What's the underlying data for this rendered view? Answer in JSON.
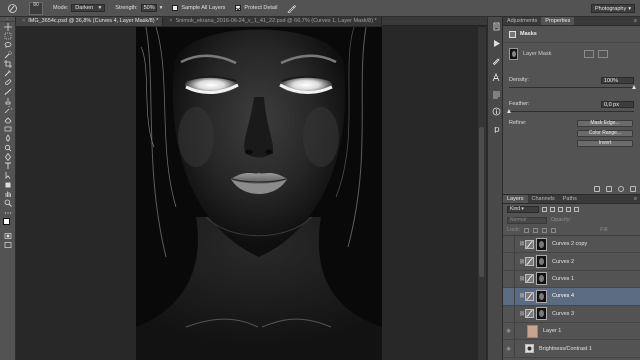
{
  "options_bar": {
    "brush_size": "80",
    "mode_label": "Mode:",
    "mode_value": "Darken",
    "strength_label": "Strength:",
    "strength_value": "50%",
    "sample_all_label": "Sample All Layers",
    "protect_detail_label": "Protect Detail",
    "workspace": "Photography"
  },
  "tabs": [
    {
      "label": "IMG_3654c.psd @ 36,8% (Curves 4, Layer Mask/8) *"
    },
    {
      "label": "Snimok_ekrana_2016-06-24_v_1_41_22.psd @ 66,7% (Curves 1, Layer Mask/8) *"
    }
  ],
  "panel_tabs": {
    "adjustments": "Adjustments",
    "properties": "Properties"
  },
  "properties": {
    "title": "Masks",
    "mask_type": "Layer Mask",
    "density_label": "Density:",
    "density_value": "100%",
    "density_level": 1.0,
    "feather_label": "Feather:",
    "feather_value": "0,0 px",
    "feather_level": 0.0,
    "refine_label": "Refine:",
    "mask_edge": "Mask Edge...",
    "color_range": "Color Range...",
    "invert": "Invert"
  },
  "layers_panel": {
    "tabs": [
      "Layers",
      "Channels",
      "Paths"
    ],
    "kind": "Kind",
    "blend_mode": "Normal",
    "opacity_label": "Opacity:",
    "lock_label": "Lock:",
    "fill_label": "Fill:",
    "layers": [
      {
        "name": "Curves 2 copy",
        "selected": false
      },
      {
        "name": "Curves 2",
        "selected": false
      },
      {
        "name": "Curves 1",
        "selected": false
      },
      {
        "name": "Curves 4",
        "selected": true
      },
      {
        "name": "Curves 3",
        "selected": false
      }
    ],
    "photo_layer": "Layer 1",
    "bottom_layer": "Brightness/Contrast 1"
  }
}
